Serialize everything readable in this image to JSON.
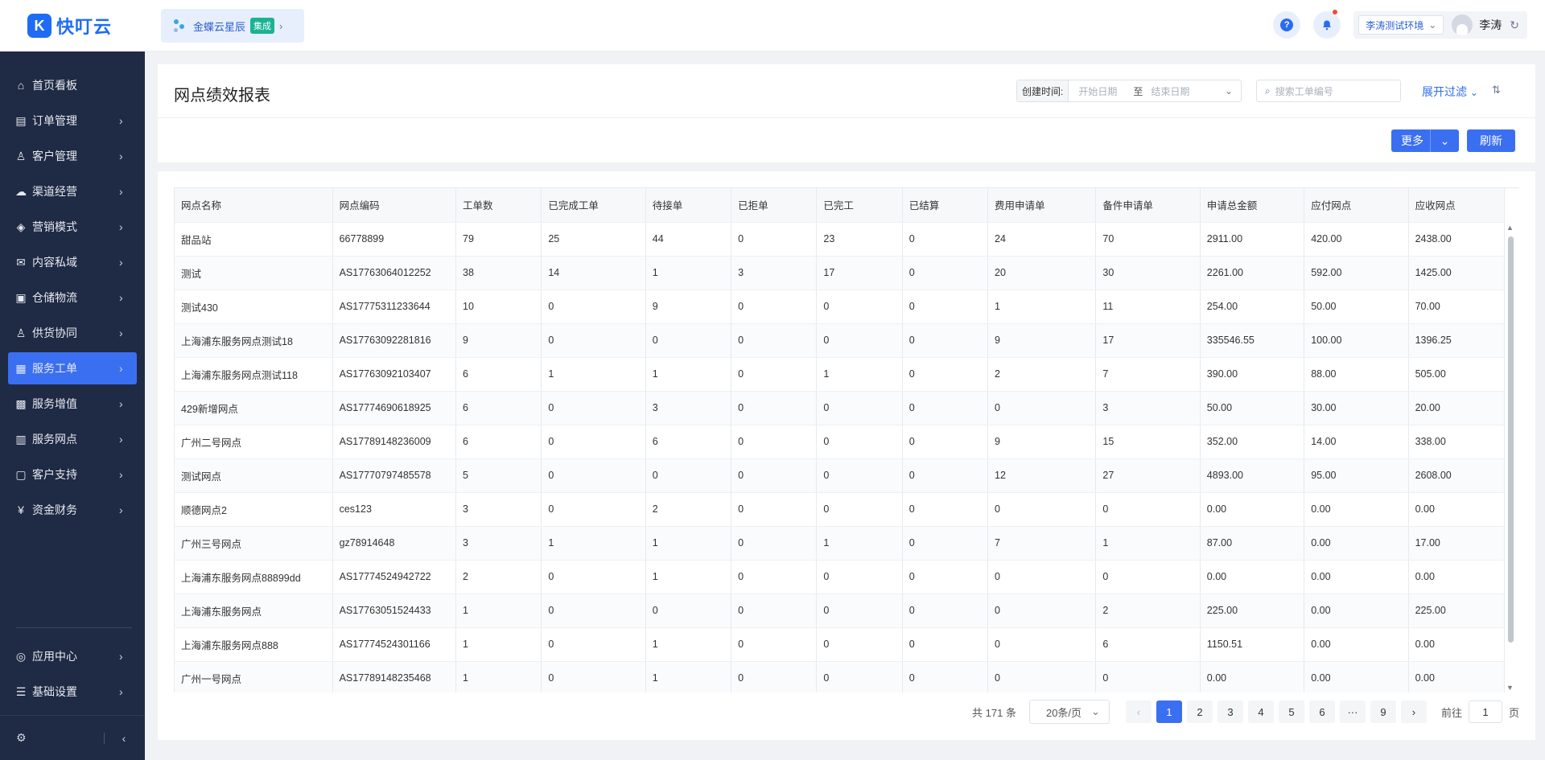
{
  "app": {
    "logo_text": "快叮云",
    "logo_mark": "K"
  },
  "integration": {
    "name": "金蝶云星辰",
    "tag": "集成"
  },
  "topbar": {
    "env": "李涛测试环境",
    "user": "李涛",
    "help": "?"
  },
  "sidebar": {
    "items": [
      {
        "label": "首页看板",
        "icon": "home-icon",
        "glyph": "⌂",
        "has_children": false
      },
      {
        "label": "订单管理",
        "icon": "order-icon",
        "glyph": "▤",
        "has_children": true
      },
      {
        "label": "客户管理",
        "icon": "user-icon",
        "glyph": "♙",
        "has_children": true
      },
      {
        "label": "渠道经营",
        "icon": "channel-icon",
        "glyph": "☁",
        "has_children": true
      },
      {
        "label": "营销模式",
        "icon": "tag-icon",
        "glyph": "◈",
        "has_children": true
      },
      {
        "label": "内容私域",
        "icon": "mail-icon",
        "glyph": "✉",
        "has_children": true
      },
      {
        "label": "仓储物流",
        "icon": "box-icon",
        "glyph": "▣",
        "has_children": true
      },
      {
        "label": "供货协同",
        "icon": "supplier-icon",
        "glyph": "♙",
        "has_children": true
      },
      {
        "label": "服务工单",
        "icon": "workorder-icon",
        "glyph": "▦",
        "has_children": true,
        "active": true
      },
      {
        "label": "服务增值",
        "icon": "gift-icon",
        "glyph": "▩",
        "has_children": true
      },
      {
        "label": "服务网点",
        "icon": "store-icon",
        "glyph": "▥",
        "has_children": true
      },
      {
        "label": "客户支持",
        "icon": "support-icon",
        "glyph": "▢",
        "has_children": true
      },
      {
        "label": "资金财务",
        "icon": "finance-icon",
        "glyph": "¥",
        "has_children": true
      }
    ],
    "bottom_items": [
      {
        "label": "应用中心",
        "icon": "app-center-icon",
        "glyph": "◎"
      },
      {
        "label": "基础设置",
        "icon": "settings-icon",
        "glyph": "☰"
      }
    ]
  },
  "page": {
    "title": "网点绩效报表",
    "filter": {
      "label": "创建时间:",
      "start_placeholder": "开始日期",
      "separator": "至",
      "end_placeholder": "结束日期"
    },
    "search_placeholder": "搜索工单编号",
    "expand_filter": "展开过滤",
    "more_button": "更多",
    "refresh_button": "刷新"
  },
  "table": {
    "columns": [
      "网点名称",
      "网点编码",
      "工单数",
      "已完成工单",
      "待接单",
      "已拒单",
      "已完工",
      "已结算",
      "费用申请单",
      "备件申请单",
      "申请总金额",
      "应付网点",
      "应收网点"
    ],
    "rows": [
      [
        "甜品站",
        "66778899",
        "79",
        "25",
        "44",
        "0",
        "23",
        "0",
        "24",
        "70",
        "2911.00",
        "420.00",
        "2438.00"
      ],
      [
        "测试",
        "AS17763064012252",
        "38",
        "14",
        "1",
        "3",
        "17",
        "0",
        "20",
        "30",
        "2261.00",
        "592.00",
        "1425.00"
      ],
      [
        "测试430",
        "AS17775311233644",
        "10",
        "0",
        "9",
        "0",
        "0",
        "0",
        "1",
        "11",
        "254.00",
        "50.00",
        "70.00"
      ],
      [
        "上海浦东服务网点测试18",
        "AS17763092281816",
        "9",
        "0",
        "0",
        "0",
        "0",
        "0",
        "9",
        "17",
        "335546.55",
        "100.00",
        "1396.25"
      ],
      [
        "上海浦东服务网点测试118",
        "AS17763092103407",
        "6",
        "1",
        "1",
        "0",
        "1",
        "0",
        "2",
        "7",
        "390.00",
        "88.00",
        "505.00"
      ],
      [
        "429新增网点",
        "AS17774690618925",
        "6",
        "0",
        "3",
        "0",
        "0",
        "0",
        "0",
        "3",
        "50.00",
        "30.00",
        "20.00"
      ],
      [
        "广州二号网点",
        "AS17789148236009",
        "6",
        "0",
        "6",
        "0",
        "0",
        "0",
        "9",
        "15",
        "352.00",
        "14.00",
        "338.00"
      ],
      [
        "测试网点",
        "AS17770797485578",
        "5",
        "0",
        "0",
        "0",
        "0",
        "0",
        "12",
        "27",
        "4893.00",
        "95.00",
        "2608.00"
      ],
      [
        "顺德网点2",
        "ces123",
        "3",
        "0",
        "2",
        "0",
        "0",
        "0",
        "0",
        "0",
        "0.00",
        "0.00",
        "0.00"
      ],
      [
        "广州三号网点",
        "gz78914648",
        "3",
        "1",
        "1",
        "0",
        "1",
        "0",
        "7",
        "1",
        "87.00",
        "0.00",
        "17.00"
      ],
      [
        "上海浦东服务网点88899dd",
        "AS17774524942722",
        "2",
        "0",
        "1",
        "0",
        "0",
        "0",
        "0",
        "0",
        "0.00",
        "0.00",
        "0.00"
      ],
      [
        "上海浦东服务网点",
        "AS17763051524433",
        "1",
        "0",
        "0",
        "0",
        "0",
        "0",
        "0",
        "2",
        "225.00",
        "0.00",
        "225.00"
      ],
      [
        "上海浦东服务网点888",
        "AS17774524301166",
        "1",
        "0",
        "1",
        "0",
        "0",
        "0",
        "0",
        "6",
        "1150.51",
        "0.00",
        "0.00"
      ],
      [
        "广州一号网点",
        "AS17789148235468",
        "1",
        "0",
        "1",
        "0",
        "0",
        "0",
        "0",
        "0",
        "0.00",
        "0.00",
        "0.00"
      ]
    ]
  },
  "pagination": {
    "total_text": "共 171 条",
    "page_size": "20条/页",
    "pages": [
      "1",
      "2",
      "3",
      "4",
      "5",
      "6",
      "···",
      "9"
    ],
    "current": "1",
    "goto_label": "前往",
    "goto_value": "1",
    "page_unit": "页"
  },
  "colors": {
    "primary": "#3b6ff2",
    "sidebar_bg": "#1f2a44"
  }
}
